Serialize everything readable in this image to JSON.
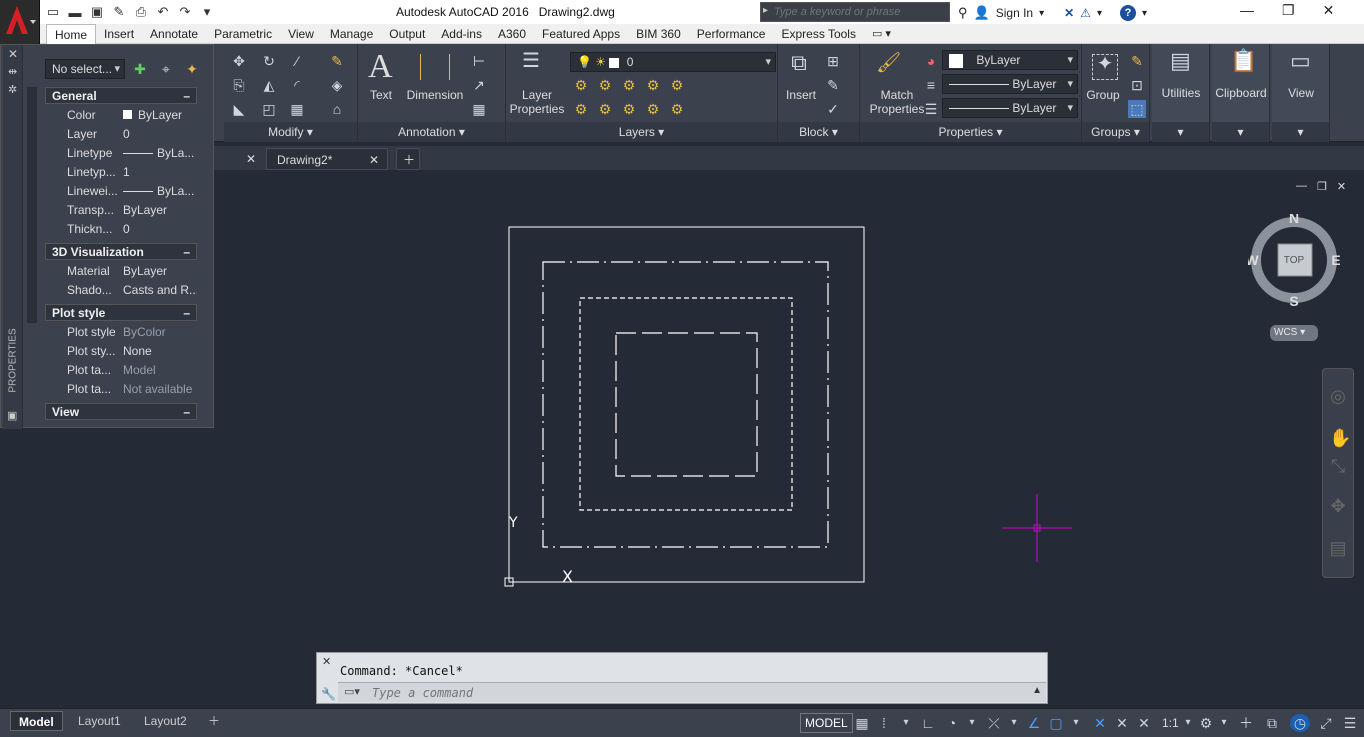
{
  "title_bar": {
    "app_title": "Autodesk AutoCAD 2016   Drawing2.dwg",
    "search_placeholder": "Type a keyword or phrase",
    "sign_in": "Sign In"
  },
  "ribbon_tabs": [
    "Home",
    "Insert",
    "Annotate",
    "Parametric",
    "View",
    "Manage",
    "Output",
    "Add-ins",
    "A360",
    "Featured Apps",
    "BIM 360",
    "Performance",
    "Express Tools"
  ],
  "ribbon": {
    "modify_title": "Modify",
    "annotation": {
      "title": "Annotation",
      "text_label": "Text",
      "dimension_label": "Dimension"
    },
    "layers": {
      "title": "Layers",
      "layer_properties_label": "Layer\nProperties",
      "current_layer": "0"
    },
    "block": {
      "title": "Block",
      "insert_label": "Insert"
    },
    "properties": {
      "title": "Properties",
      "match_label": "Match\nProperties",
      "color": "ByLayer",
      "linetype": "ByLayer",
      "lineweight": "ByLayer"
    },
    "groups": {
      "title": "Groups",
      "group_label": "Group"
    },
    "utilities_label": "Utilities",
    "clipboard_label": "Clipboard",
    "view_label": "View"
  },
  "doc_tabs": [
    {
      "label": "Drawing2*"
    }
  ],
  "properties_palette": {
    "vertical_title": "PROPERTIES",
    "selection": "No select...",
    "sections": [
      {
        "title": "General",
        "rows": [
          {
            "name": "Color",
            "value": "ByLayer"
          },
          {
            "name": "Layer",
            "value": "0"
          },
          {
            "name": "Linetype",
            "value": "ByLa..."
          },
          {
            "name": "Linetyp...",
            "value": "1"
          },
          {
            "name": "Linewei...",
            "value": "ByLa..."
          },
          {
            "name": "Transp...",
            "value": "ByLayer"
          },
          {
            "name": "Thickn...",
            "value": "0"
          }
        ]
      },
      {
        "title": "3D Visualization",
        "rows": [
          {
            "name": "Material",
            "value": "ByLayer"
          },
          {
            "name": "Shado...",
            "value": "Casts and R..."
          }
        ]
      },
      {
        "title": "Plot style",
        "rows": [
          {
            "name": "Plot style",
            "value": "ByColor"
          },
          {
            "name": "Plot sty...",
            "value": "None"
          },
          {
            "name": "Plot ta...",
            "value": "Model"
          },
          {
            "name": "Plot ta...",
            "value": "Not available"
          }
        ]
      },
      {
        "title": "View",
        "rows": []
      }
    ]
  },
  "viewcube": {
    "face": "TOP",
    "n": "N",
    "s": "S",
    "e": "E",
    "w": "W",
    "wcs": "WCS"
  },
  "ucs": {
    "y": "Y",
    "x": "X"
  },
  "command": {
    "history": "Command: *Cancel*",
    "placeholder": "Type a command"
  },
  "layout_tabs": [
    "Model",
    "Layout1",
    "Layout2"
  ],
  "status": {
    "model": "MODEL",
    "scale": "1:1"
  },
  "colors": {
    "canvas": "#252b36",
    "crosshair": "#d200d2",
    "ribbon": "#3b414d"
  }
}
